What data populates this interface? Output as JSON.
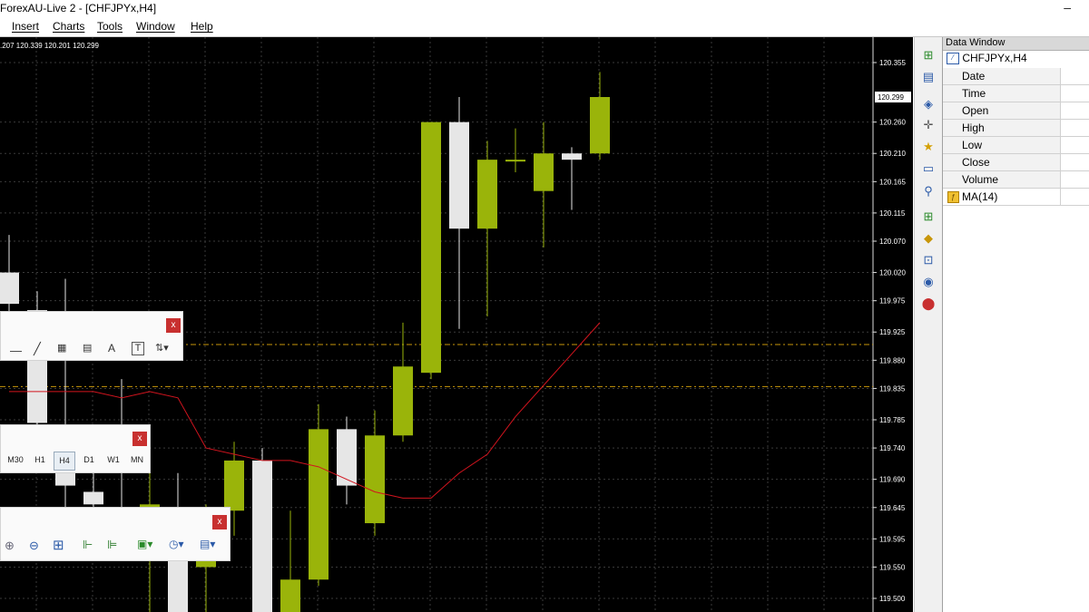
{
  "window": {
    "title": "ForexAU-Live 2 - [CHFJPYx,H4]",
    "minimize_symbol": "–"
  },
  "menu": [
    "Insert",
    "Charts",
    "Tools",
    "Window",
    "Help"
  ],
  "chart": {
    "symbol": "CHFJPYx",
    "timeframe": "H4",
    "ohlc_readout": ".207 120.339 120.201 120.299",
    "current_price_label": "120.299",
    "price_axis": [
      "120.355",
      "120.260",
      "120.210",
      "120.165",
      "120.115",
      "120.070",
      "120.020",
      "119.975",
      "119.925",
      "119.880",
      "119.835",
      "119.785",
      "119.740",
      "119.690",
      "119.645",
      "119.595",
      "119.550",
      "119.500"
    ],
    "colors": {
      "background": "#000000",
      "bull_candle": "#9ab40a",
      "bear_candle": "#e6e6e6",
      "ma_line": "#d2141e",
      "level_line": "#c8960a",
      "grid": "#3a3a3a",
      "axis_text": "#ffffff"
    },
    "indicator": "MA(14)",
    "horizontal_levels": [
      119.905,
      119.838
    ],
    "candles": [
      {
        "o": 120.02,
        "h": 120.08,
        "l": 119.92,
        "c": 119.97
      },
      {
        "o": 119.96,
        "h": 119.99,
        "l": 119.77,
        "c": 119.78
      },
      {
        "o": 119.77,
        "h": 120.01,
        "l": 119.62,
        "c": 119.68
      },
      {
        "o": 119.67,
        "h": 119.7,
        "l": 119.58,
        "c": 119.65
      },
      {
        "o": 119.75,
        "h": 119.85,
        "l": 119.56,
        "c": 119.7
      },
      {
        "o": 119.6,
        "h": 119.7,
        "l": 119.4,
        "c": 119.65
      },
      {
        "o": 119.6,
        "h": 119.7,
        "l": 119.45,
        "c": 119.45
      },
      {
        "o": 119.55,
        "h": 119.65,
        "l": 119.4,
        "c": 119.64
      },
      {
        "o": 119.64,
        "h": 119.75,
        "l": 119.6,
        "c": 119.72
      },
      {
        "o": 119.72,
        "h": 119.74,
        "l": 119.46,
        "c": 119.46
      },
      {
        "o": 119.46,
        "h": 119.64,
        "l": 119.45,
        "c": 119.53
      },
      {
        "o": 119.53,
        "h": 119.81,
        "l": 119.52,
        "c": 119.77
      },
      {
        "o": 119.77,
        "h": 119.79,
        "l": 119.65,
        "c": 119.68
      },
      {
        "o": 119.62,
        "h": 119.8,
        "l": 119.6,
        "c": 119.76
      },
      {
        "o": 119.76,
        "h": 119.94,
        "l": 119.75,
        "c": 119.87
      },
      {
        "o": 119.86,
        "h": 120.26,
        "l": 119.85,
        "c": 120.26
      },
      {
        "o": 120.26,
        "h": 120.3,
        "l": 119.93,
        "c": 120.09
      },
      {
        "o": 120.09,
        "h": 120.23,
        "l": 119.95,
        "c": 120.2
      },
      {
        "o": 120.2,
        "h": 120.25,
        "l": 120.18,
        "c": 120.2
      },
      {
        "o": 120.15,
        "h": 120.26,
        "l": 120.06,
        "c": 120.21
      },
      {
        "o": 120.21,
        "h": 120.22,
        "l": 120.12,
        "c": 120.2
      },
      {
        "o": 120.21,
        "h": 120.34,
        "l": 120.2,
        "c": 120.3
      }
    ],
    "ma_values": [
      119.83,
      119.83,
      119.83,
      119.83,
      119.82,
      119.83,
      119.82,
      119.74,
      119.73,
      119.72,
      119.72,
      119.71,
      119.69,
      119.67,
      119.66,
      119.66,
      119.7,
      119.73,
      119.79,
      119.84,
      119.89,
      119.94
    ]
  },
  "toolbars": {
    "line_studies": {
      "close_label": "x",
      "text_tool": "A",
      "label_tool": "T"
    },
    "periods": {
      "close_label": "x",
      "items": [
        "M30",
        "H1",
        "H4",
        "D1",
        "W1",
        "MN"
      ],
      "active": "H4"
    },
    "charts": {
      "close_label": "x"
    }
  },
  "data_window": {
    "title": "Data Window",
    "symbol": "CHFJPYx,H4",
    "rows": [
      "Date",
      "Time",
      "Open",
      "High",
      "Low",
      "Close",
      "Volume"
    ],
    "indicator_row": "MA(14)"
  },
  "icons": [
    "new-order-icon",
    "templates-icon",
    "market-watch-icon",
    "navigator-crosshair-icon",
    "favorites-icon",
    "terminal-icon",
    "strategy-tester-icon",
    "new-chart-icon",
    "eraser-icon",
    "signals-icon",
    "vps-icon",
    "alert-icon"
  ]
}
